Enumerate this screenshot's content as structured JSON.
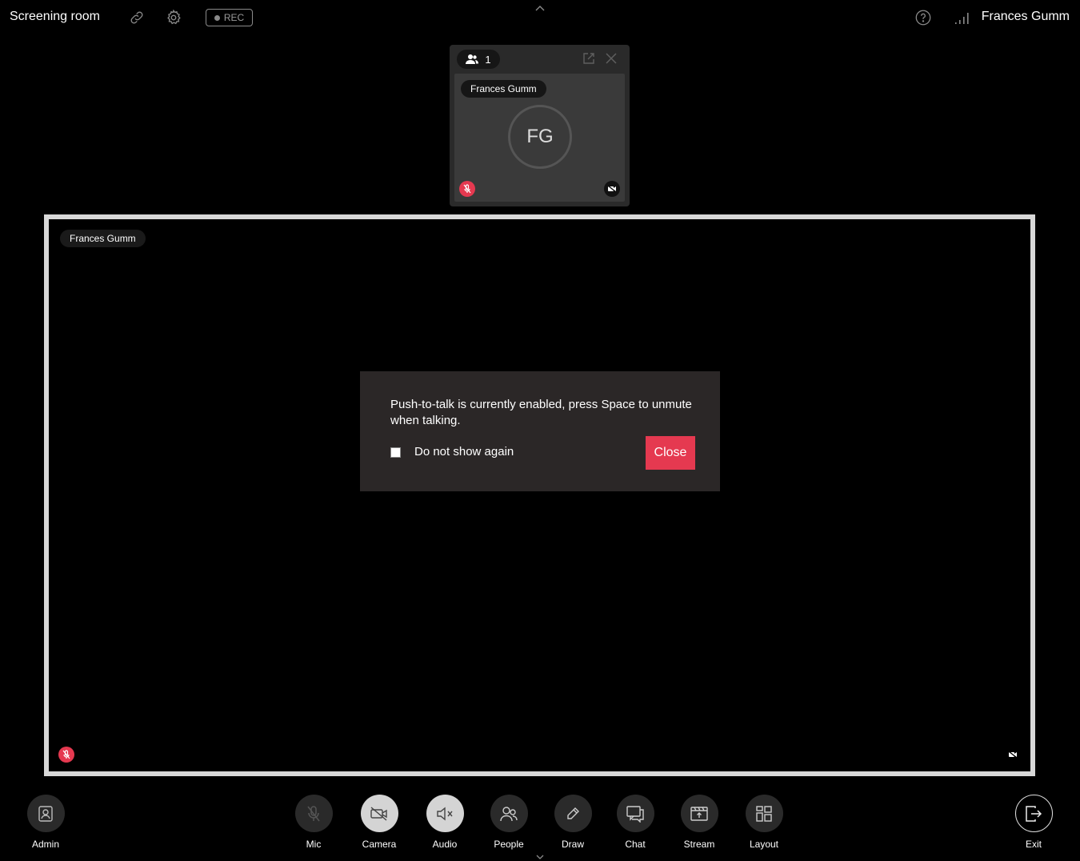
{
  "header": {
    "room_title": "Screening room",
    "rec_label": "REC",
    "user_name": "Frances Gumm"
  },
  "participants_panel": {
    "count": "1",
    "tile": {
      "name": "Frances Gumm",
      "initials": "FG",
      "mic_muted": true,
      "camera_off": true
    }
  },
  "stage": {
    "name": "Frances Gumm",
    "mic_muted": true,
    "camera_off": true
  },
  "modal": {
    "message": "Push-to-talk is currently enabled, press Space to unmute when talking.",
    "checkbox_label": "Do not show again",
    "checkbox_checked": false,
    "close_label": "Close"
  },
  "toolbar": {
    "admin": "Admin",
    "mic": "Mic",
    "camera": "Camera",
    "audio": "Audio",
    "people": "People",
    "draw": "Draw",
    "chat": "Chat",
    "stream": "Stream",
    "layout": "Layout",
    "exit": "Exit"
  },
  "colors": {
    "accent_red": "#e53950",
    "modal_bg": "#2b2727",
    "stage_border": "#d8d8d8"
  }
}
